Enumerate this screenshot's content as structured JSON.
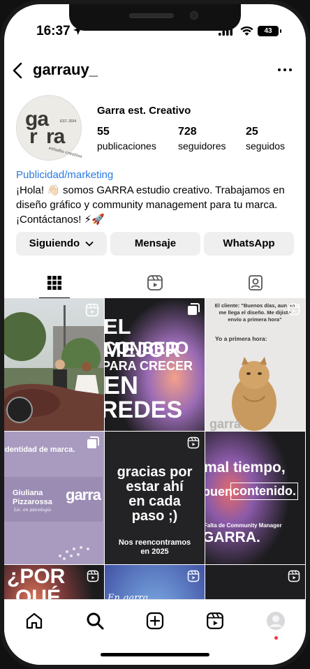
{
  "status_bar": {
    "time": "16:37",
    "battery": "43"
  },
  "header": {
    "username": "garrauy_"
  },
  "profile": {
    "avatar_text": "garra",
    "avatar_small": "EST. 2024",
    "avatar_sub": "estudio creativo",
    "display_name": "Garra est. Creativo",
    "stats": [
      {
        "value": "55",
        "label": "publicaciones"
      },
      {
        "value": "728",
        "label": "seguidores"
      },
      {
        "value": "25",
        "label": "seguidos"
      }
    ],
    "category": "Publicidad/marketing",
    "bio_line1": "¡Hola! 👋🏻 somos GARRA estudio creativo. Trabajamos en",
    "bio_line2": "diseño gráfico y community management para tu marca.",
    "bio_line3": "¡Contáctanos! ⚡🚀"
  },
  "actions": {
    "follow": "Siguiendo",
    "message": "Mensaje",
    "whatsapp": "WhatsApp"
  },
  "posts": {
    "p2_lines": [
      "EL MEJOR",
      "CONSEJO",
      "PARA CRECER",
      "EN",
      "REDES"
    ],
    "p3_line1": "El cliente: \"Buenos días, aun no",
    "p3_line2": "me llega el diseño. Me dijiste",
    "p3_line3": "envío a primera hora\"",
    "p3_line4": "Yo a primera hora:",
    "p3_brand": "garra",
    "p4_top": "identidad de marca.",
    "p4_name1": "Giuliana",
    "p4_name2": "Pizzarossa",
    "p4_sub": "Lic. en psicología",
    "p4_brand": "garra",
    "p5_line1": "gracias por",
    "p5_line2": "estar ahí",
    "p5_line3": "en cada",
    "p5_line4": "paso ;)",
    "p5_line5": "Nos reencontramos",
    "p5_line6": "en 2025",
    "p6_line1": "mal tiempo,",
    "p6_line2a": "buen",
    "p6_line2b": "contenido.",
    "p6_line3": "Falta de Community Manager",
    "p6_line4": "GARRA.",
    "p7_line1": "¿POR",
    "p7_line2": "QUÉ",
    "p8_line1": "En garra"
  },
  "colors": {
    "link": "#2a7ae2",
    "button_bg": "#efefef",
    "avatar_bg": "#ecebe6"
  }
}
